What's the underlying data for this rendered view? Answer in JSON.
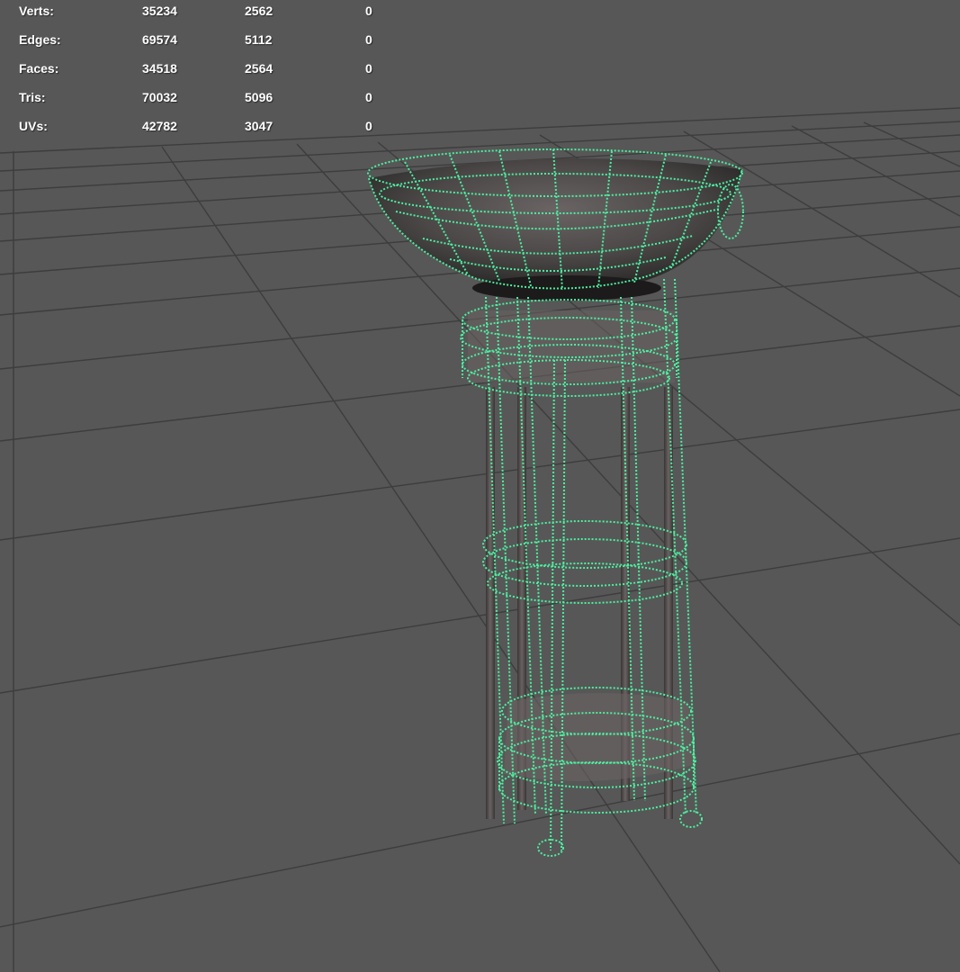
{
  "viewport": {
    "background_color": "#575757",
    "grid_color": "#3a3a3a",
    "wireframe_color": "#4cf0a0",
    "object": "brazier-stand-wireframe-mesh"
  },
  "heads_up_display": {
    "rows": [
      {
        "label": "Verts:",
        "values": [
          "35234",
          "2562",
          "0"
        ]
      },
      {
        "label": "Edges:",
        "values": [
          "69574",
          "5112",
          "0"
        ]
      },
      {
        "label": "Faces:",
        "values": [
          "34518",
          "2564",
          "0"
        ]
      },
      {
        "label": "Tris:",
        "values": [
          "70032",
          "5096",
          "0"
        ]
      },
      {
        "label": "UVs:",
        "values": [
          "42782",
          "3047",
          "0"
        ]
      }
    ]
  }
}
